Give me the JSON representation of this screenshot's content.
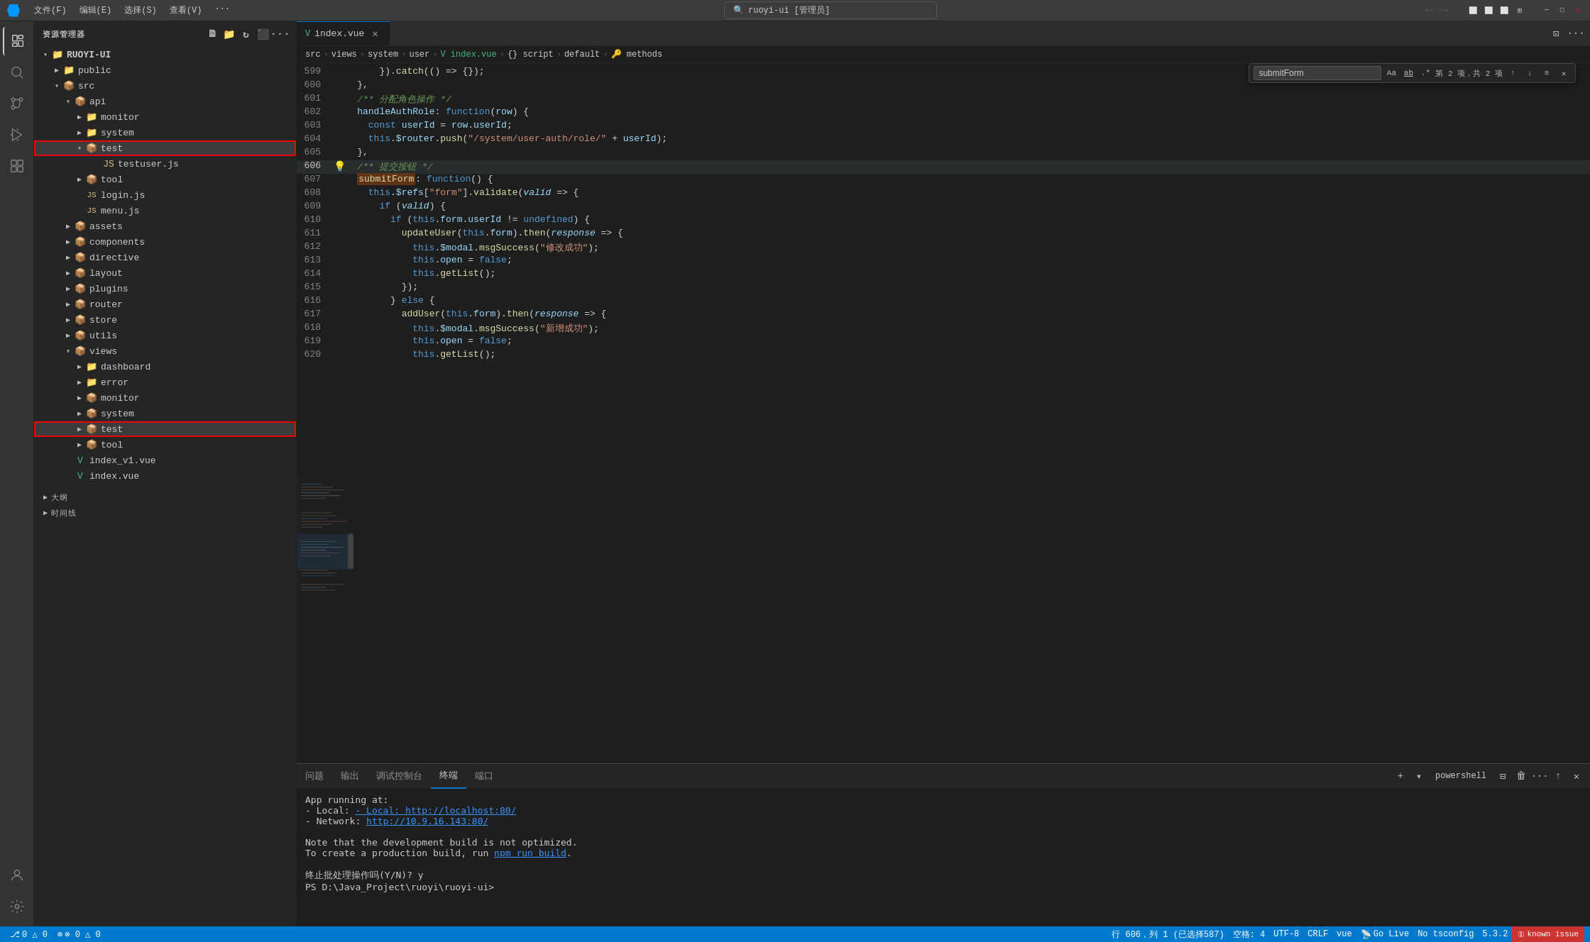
{
  "titleBar": {
    "menus": [
      "文件(F)",
      "编辑(E)",
      "选择(S)",
      "查看(V)",
      "···"
    ],
    "search": "ruoyi-ui [管理员]",
    "navBack": "←",
    "navForward": "→"
  },
  "tabs": [
    {
      "label": "index.vue",
      "icon": "vue",
      "active": true,
      "closable": true
    }
  ],
  "breadcrumb": {
    "items": [
      "src",
      "views",
      "system",
      "user",
      "index.vue",
      "{} script",
      "default",
      "methods"
    ]
  },
  "findBar": {
    "value": "submitForm",
    "count": "第 2 项，共 2 项",
    "buttons": [
      "Aa",
      "ab̲",
      ".*",
      "↑",
      "↓",
      "≡",
      "✕"
    ]
  },
  "sidebar": {
    "title": "资源管理器",
    "root": "RUOYI-UI",
    "tree": [
      {
        "id": "public",
        "label": "public",
        "type": "folder",
        "depth": 1,
        "open": false
      },
      {
        "id": "src",
        "label": "src",
        "type": "folder-src",
        "depth": 1,
        "open": true
      },
      {
        "id": "api",
        "label": "api",
        "type": "folder",
        "depth": 2,
        "open": true
      },
      {
        "id": "monitor",
        "label": "monitor",
        "type": "folder",
        "depth": 3,
        "open": false
      },
      {
        "id": "system",
        "label": "system",
        "type": "folder",
        "depth": 3,
        "open": false
      },
      {
        "id": "test",
        "label": "test",
        "type": "folder-test",
        "depth": 3,
        "open": true,
        "highlighted": true
      },
      {
        "id": "testuser",
        "label": "testuser.js",
        "type": "js",
        "depth": 4
      },
      {
        "id": "tool",
        "label": "tool",
        "type": "folder",
        "depth": 3,
        "open": false
      },
      {
        "id": "login",
        "label": "login.js",
        "type": "js",
        "depth": 3
      },
      {
        "id": "menu",
        "label": "menu.js",
        "type": "js",
        "depth": 3
      },
      {
        "id": "assets",
        "label": "assets",
        "type": "folder",
        "depth": 2,
        "open": false
      },
      {
        "id": "components",
        "label": "components",
        "type": "folder",
        "depth": 2,
        "open": false
      },
      {
        "id": "directive",
        "label": "directive",
        "type": "folder",
        "depth": 2,
        "open": false
      },
      {
        "id": "layout",
        "label": "layout",
        "type": "folder",
        "depth": 2,
        "open": false
      },
      {
        "id": "plugins",
        "label": "plugins",
        "type": "folder",
        "depth": 2,
        "open": false
      },
      {
        "id": "router",
        "label": "router",
        "type": "folder",
        "depth": 2,
        "open": false
      },
      {
        "id": "store",
        "label": "store",
        "type": "folder",
        "depth": 2,
        "open": false
      },
      {
        "id": "utils",
        "label": "utils",
        "type": "folder",
        "depth": 2,
        "open": false
      },
      {
        "id": "views",
        "label": "views",
        "type": "folder-src",
        "depth": 2,
        "open": true
      },
      {
        "id": "dashboard",
        "label": "dashboard",
        "type": "folder",
        "depth": 3,
        "open": false
      },
      {
        "id": "error",
        "label": "error",
        "type": "folder",
        "depth": 3,
        "open": false
      },
      {
        "id": "vmonitor",
        "label": "monitor",
        "type": "folder",
        "depth": 3,
        "open": false
      },
      {
        "id": "vsystem",
        "label": "system",
        "type": "folder",
        "depth": 3,
        "open": false
      },
      {
        "id": "vtest",
        "label": "test",
        "type": "folder-test",
        "depth": 3,
        "open": false,
        "highlighted": true
      },
      {
        "id": "vtool",
        "label": "tool",
        "type": "folder",
        "depth": 3,
        "open": false
      },
      {
        "id": "index_v1",
        "label": "index_v1.vue",
        "type": "vue",
        "depth": 2
      },
      {
        "id": "index_main",
        "label": "index.vue",
        "type": "vue",
        "depth": 2
      }
    ],
    "bottomItems": [
      "大纲",
      "时间线"
    ]
  },
  "codeLines": [
    {
      "num": 599,
      "content": "        }).catch(() => {});"
    },
    {
      "num": 600,
      "content": "    },"
    },
    {
      "num": 601,
      "content": "    /** 分配角色操作 */"
    },
    {
      "num": 602,
      "content": "    handleAuthRole: function(row) {"
    },
    {
      "num": 603,
      "content": "      const userId = row.userId;"
    },
    {
      "num": 604,
      "content": "      this.$router.push(\"/system/user-auth/role/\" + userId);"
    },
    {
      "num": 605,
      "content": "    },"
    },
    {
      "num": 606,
      "content": "    /** 提交按钮 */",
      "lightbulb": true,
      "active": true
    },
    {
      "num": 607,
      "content": "    submitForm: function() {"
    },
    {
      "num": 608,
      "content": "      this.$refs[\"form\"].validate(valid => {"
    },
    {
      "num": 609,
      "content": "        if (valid) {"
    },
    {
      "num": 610,
      "content": "          if (this.form.userId != undefined) {"
    },
    {
      "num": 611,
      "content": "            updateUser(this.form).then(response => {"
    },
    {
      "num": 612,
      "content": "              this.$modal.msgSuccess(\"修改成功\");"
    },
    {
      "num": 613,
      "content": "              this.open = false;"
    },
    {
      "num": 614,
      "content": "              this.getList();"
    },
    {
      "num": 615,
      "content": "            });"
    },
    {
      "num": 616,
      "content": "          } else {"
    },
    {
      "num": 617,
      "content": "            addUser(this.form).then(response => {"
    },
    {
      "num": 618,
      "content": "              this.$modal.msgSuccess(\"新增成功\");"
    },
    {
      "num": 619,
      "content": "              this.open = false;"
    },
    {
      "num": 620,
      "content": "              this.getList();"
    }
  ],
  "terminal": {
    "tabs": [
      "问题",
      "输出",
      "调试控制台",
      "终端",
      "端口"
    ],
    "activeTab": "终端",
    "powershell": "powershell",
    "content": [
      "App running at:",
      "  - Local:   http://localhost:80/",
      "  - Network: http://10.9.16.143:80/",
      "",
      "Note that the development build is not optimized.",
      "To create a production build, run npm run build.",
      "",
      "终止批处理操作吗(Y/N)? y",
      "PS D:\\Java_Project\\ruoyi\\ruoyi-ui>"
    ]
  },
  "statusBar": {
    "git": "⎇ 0 △ 0",
    "errors": "⊗ 0 △ 0",
    "line": "行 606，列 1 (已选择587)",
    "spaces": "空格: 4",
    "encoding": "UTF-8",
    "lineEnding": "CRLF",
    "lang": "vue",
    "liveShare": "Go Live",
    "tsconfig": "No tsconfig",
    "version": "5.3.2",
    "errorBadge": "① known issue"
  }
}
